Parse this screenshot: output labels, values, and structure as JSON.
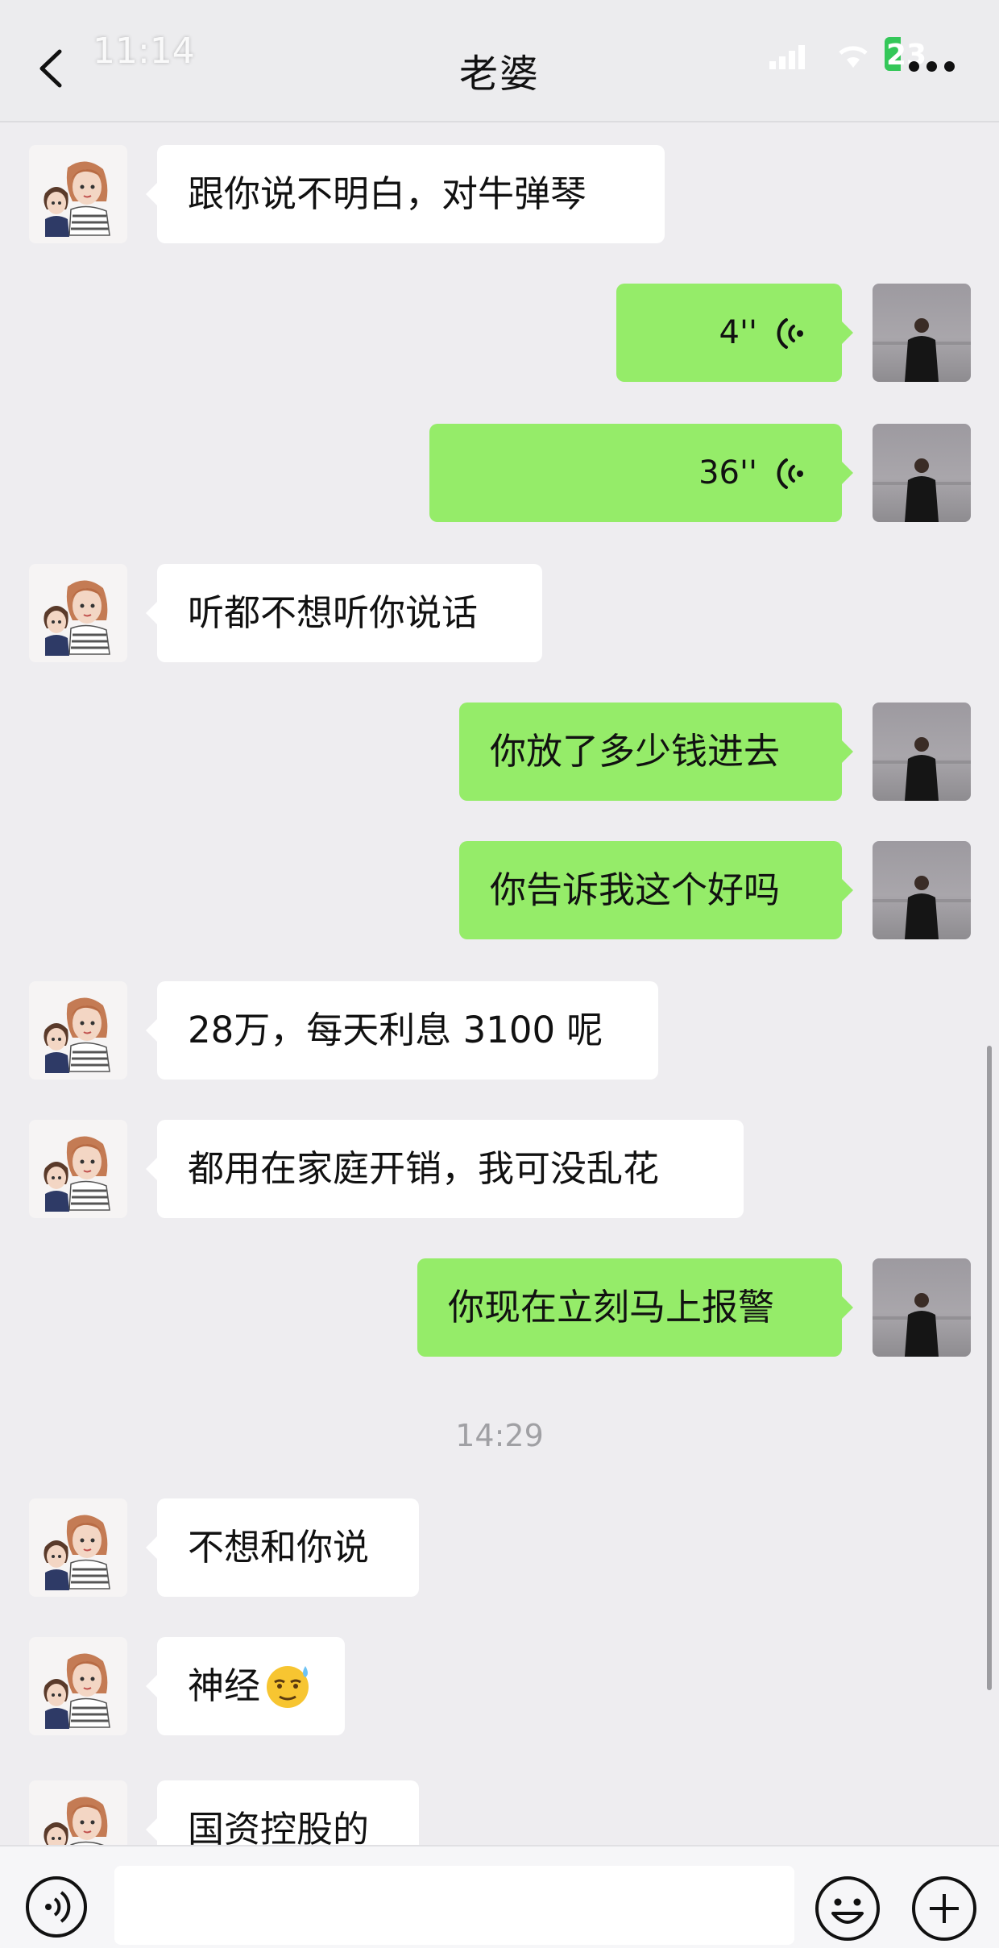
{
  "status_bar": {
    "time": "11:14",
    "battery": "23"
  },
  "header": {
    "title": "老婆"
  },
  "messages": [
    {
      "side": "in",
      "type": "text",
      "text": "跟你说不明白，对牛弹琴"
    },
    {
      "side": "out",
      "type": "voice",
      "duration": "4''"
    },
    {
      "side": "out",
      "type": "voice",
      "duration": "36''"
    },
    {
      "side": "in",
      "type": "text",
      "text": "听都不想听你说话"
    },
    {
      "side": "out",
      "type": "text",
      "text": "你放了多少钱进去"
    },
    {
      "side": "out",
      "type": "text",
      "text": "你告诉我这个好吗"
    },
    {
      "side": "in",
      "type": "text",
      "text": "28万，每天利息 3100 呢"
    },
    {
      "side": "in",
      "type": "text",
      "text": "都用在家庭开销，我可没乱花"
    },
    {
      "side": "out",
      "type": "text",
      "text": "你现在立刻马上报警"
    },
    {
      "side": "in",
      "type": "text",
      "text": "不想和你说"
    },
    {
      "side": "in",
      "type": "text",
      "text": "神经",
      "emoji": "sweat-smile-emoji-icon"
    },
    {
      "side": "in",
      "type": "text",
      "text": "国资控股的"
    }
  ],
  "timestamp": "14:29",
  "colors": {
    "outgoing_bubble": "#95ec69",
    "incoming_bubble": "#ffffff",
    "background": "#eeedf0"
  },
  "icons": {
    "back": "chevron-left-icon",
    "more": "more-dots-icon",
    "voice_input": "voice-input-icon",
    "emoji": "emoji-icon",
    "plus": "plus-icon"
  }
}
